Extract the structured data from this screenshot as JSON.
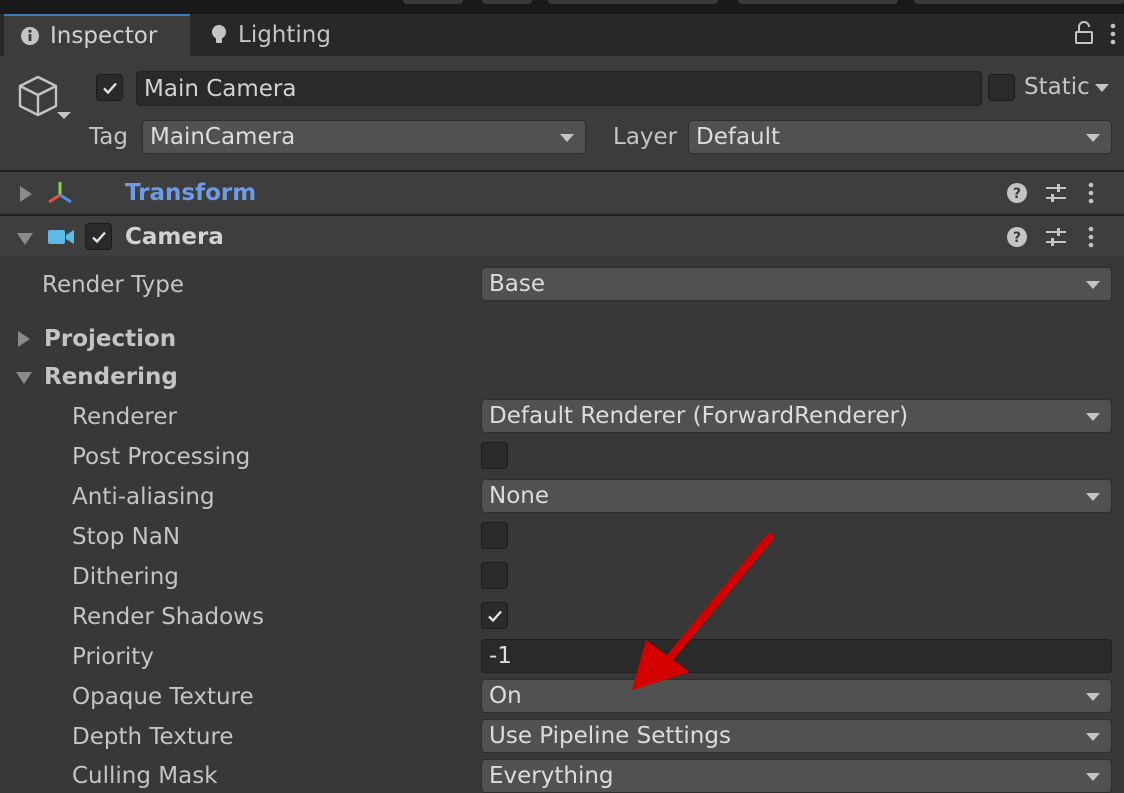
{
  "tabs": {
    "inspector": "Inspector",
    "lighting": "Lighting"
  },
  "header": {
    "object_name": "Main Camera",
    "static_label": "Static",
    "tag_label": "Tag",
    "tag_value": "MainCamera",
    "layer_label": "Layer",
    "layer_value": "Default",
    "active": true,
    "static": false
  },
  "components": {
    "transform": {
      "title": "Transform",
      "title_color": "#6d9be6"
    },
    "camera": {
      "title": "Camera",
      "enabled": true
    }
  },
  "camera": {
    "render_type": {
      "label": "Render Type",
      "value": "Base"
    },
    "projection_label": "Projection",
    "rendering_label": "Rendering",
    "rendering": {
      "renderer": {
        "label": "Renderer",
        "value": "Default Renderer (ForwardRenderer)"
      },
      "post_processing": {
        "label": "Post Processing",
        "checked": false
      },
      "anti_aliasing": {
        "label": "Anti-aliasing",
        "value": "None"
      },
      "stop_nan": {
        "label": "Stop NaN",
        "checked": false
      },
      "dithering": {
        "label": "Dithering",
        "checked": false
      },
      "render_shadows": {
        "label": "Render Shadows",
        "checked": true
      },
      "priority": {
        "label": "Priority",
        "value": "-1"
      },
      "opaque_texture": {
        "label": "Opaque Texture",
        "value": "On"
      },
      "depth_texture": {
        "label": "Depth Texture",
        "value": "Use Pipeline Settings"
      },
      "culling_mask": {
        "label": "Culling Mask",
        "value": "Everything"
      }
    }
  },
  "annotation": {
    "type": "arrow",
    "color": "#e00000",
    "points_to": "opaque-texture-dropdown"
  },
  "colors": {
    "panel_bg": "#383838",
    "tab_active_border": "#3a79bb",
    "dropdown_bg": "#515151",
    "field_bg": "#2a2a2a"
  },
  "icons": {
    "inspector_tab": "info-icon",
    "lighting_tab": "lightbulb-icon",
    "lock": "lock-icon",
    "object": "cube-icon",
    "transform": "transform-axes-icon",
    "camera": "video-camera-icon",
    "help": "help-icon",
    "presets": "presets-sliders-icon",
    "menu": "kebab-menu-icon"
  }
}
